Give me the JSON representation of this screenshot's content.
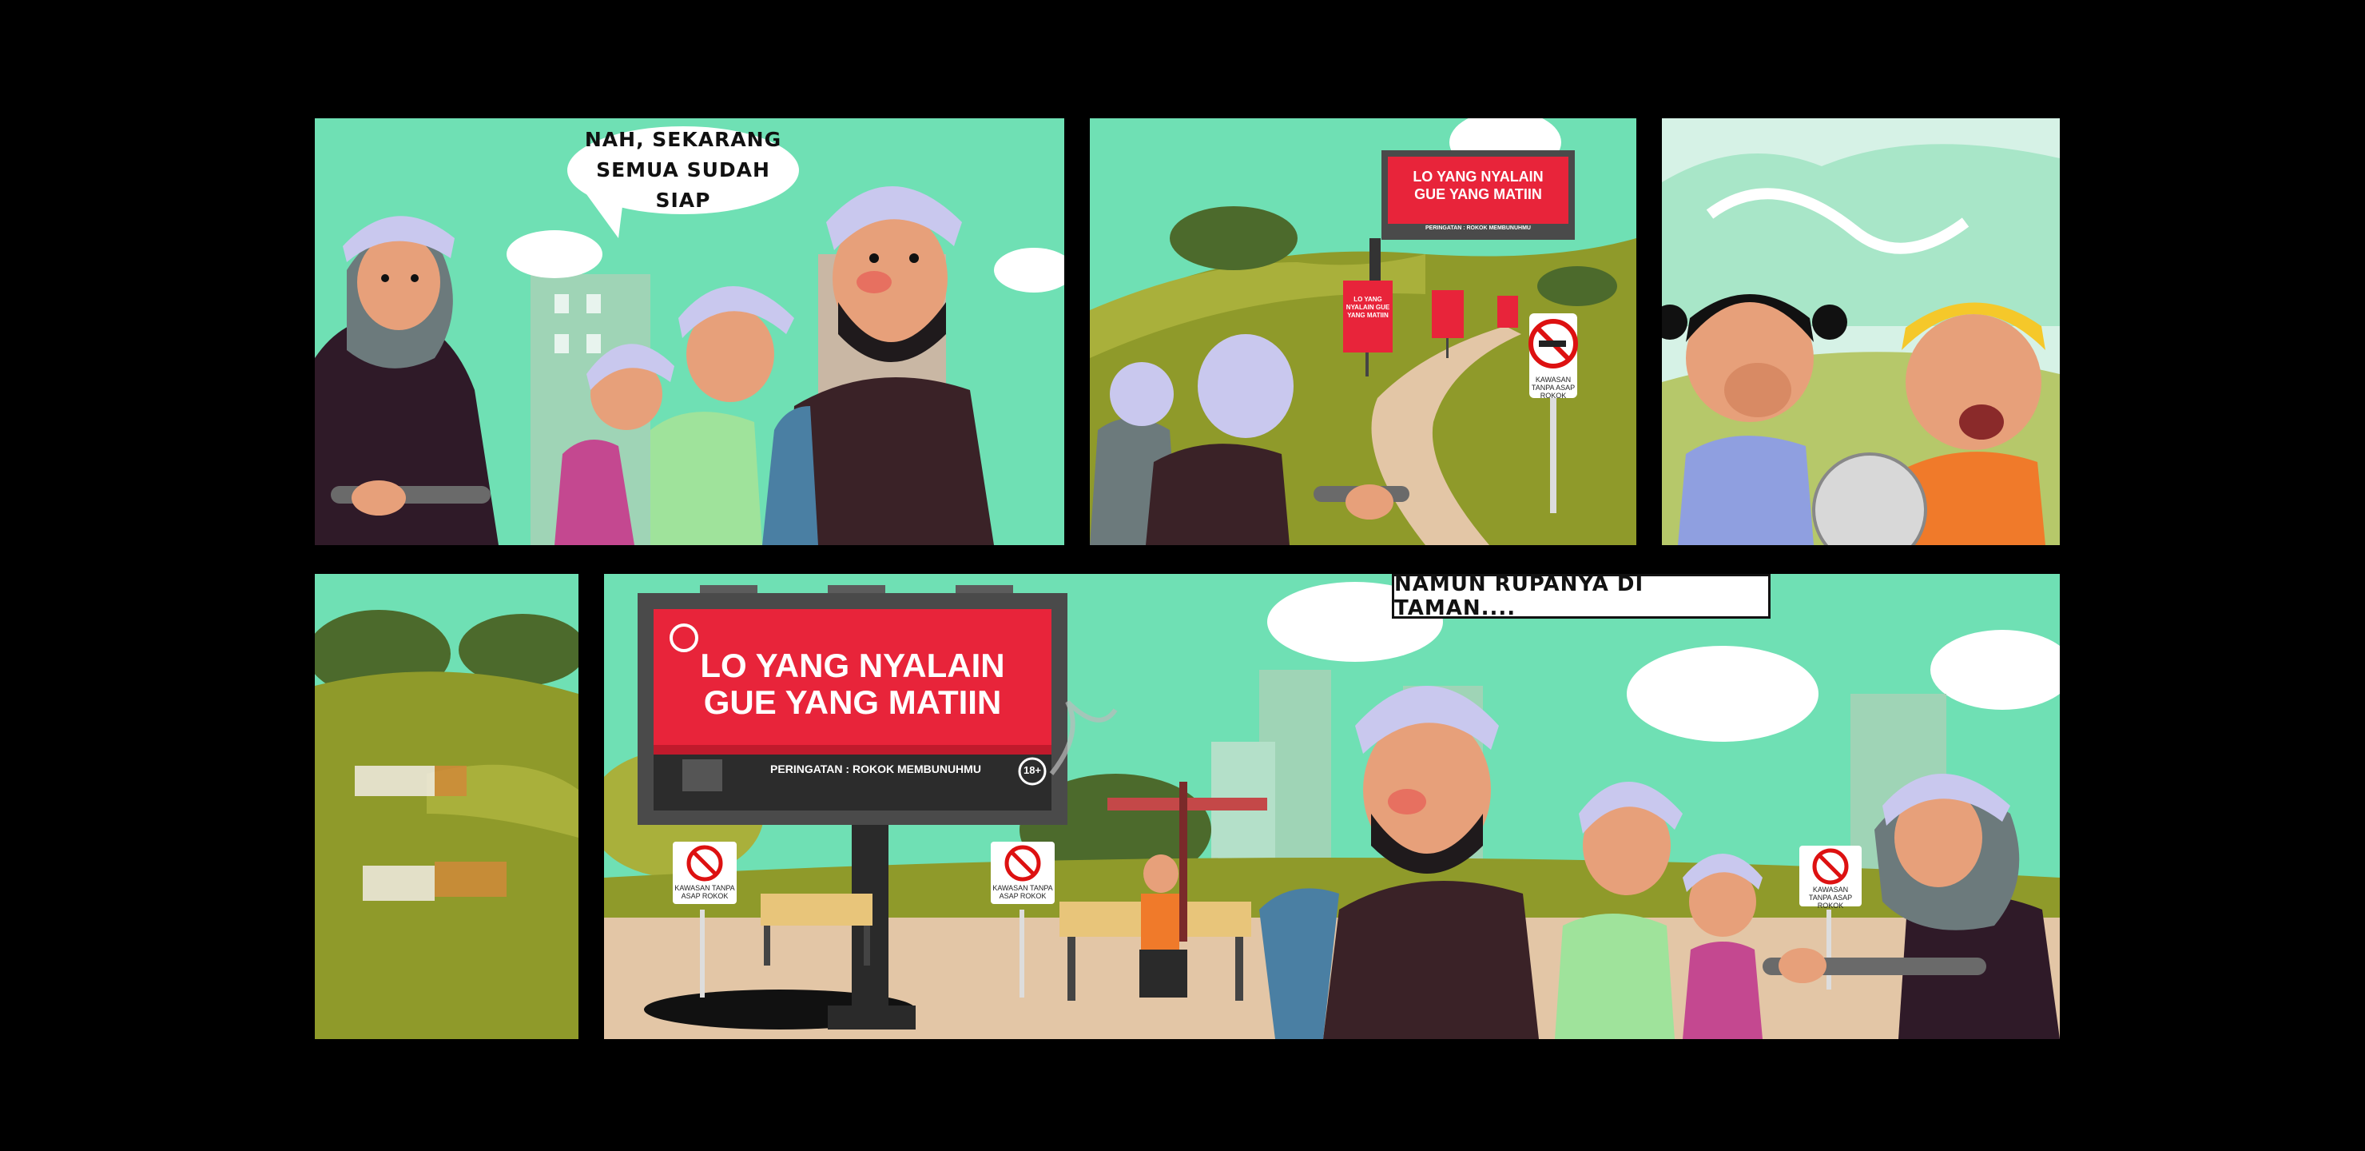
{
  "comic": {
    "panel1": {
      "speech_line1": "NAH, SEKARANG",
      "speech_line2": "SEMUA SUDAH SIAP"
    },
    "panel2": {
      "billboard_line1": "LO YANG NYALAIN",
      "billboard_line2": "GUE YANG MATIIN",
      "billboard_warning": "PERINGATAN : ROKOK MEMBUNUHMU",
      "small_board": "LO YANG NYALAIN GUE YANG MATIIN",
      "sign_label": "KAWASAN TANPA ASAP ROKOK"
    },
    "panel5": {
      "caption": "NAMUN RUPANYA DI TAMAN....",
      "billboard_line1": "LO YANG NYALAIN",
      "billboard_line2": "GUE YANG MATIIN",
      "billboard_warning": "PERINGATAN : ROKOK MEMBUNUHMU",
      "age_badge": "18+",
      "sign_label": "KAWASAN TANPA ASAP ROKOK"
    }
  },
  "colors": {
    "sky": "#6fe0b4",
    "grass": "#8f9a2a",
    "billboard_red": "#e8243a",
    "billboard_frame": "#4a4a4a",
    "background": "#000000"
  }
}
